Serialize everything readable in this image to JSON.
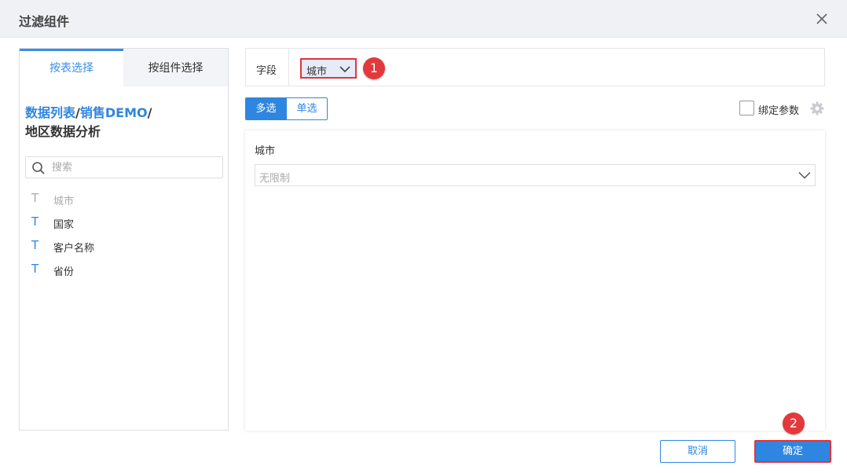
{
  "dialog": {
    "title": "过滤组件",
    "close_icon": "close-icon"
  },
  "left": {
    "tabs": [
      {
        "label": "按表选择",
        "active": true
      },
      {
        "label": "按组件选择",
        "active": false
      }
    ],
    "breadcrumb": {
      "part1": "数据列表",
      "sep1": "/",
      "part2": "销售DEMO",
      "sep2": "/",
      "part3": "地区数据分析"
    },
    "search": {
      "placeholder": "搜索",
      "value": ""
    },
    "fields": [
      {
        "icon": "T",
        "label": "城市",
        "disabled": true
      },
      {
        "icon": "T",
        "label": "国家",
        "disabled": false
      },
      {
        "icon": "T",
        "label": "客户名称",
        "disabled": false
      },
      {
        "icon": "T",
        "label": "省份",
        "disabled": false
      }
    ]
  },
  "field_bar": {
    "label": "字段",
    "selected": "城市"
  },
  "markers": {
    "m1": "1",
    "m2": "2"
  },
  "mode": {
    "multi": "多选",
    "single": "单选",
    "selected": "多选"
  },
  "bind_param": {
    "label": "绑定参数",
    "checked": false
  },
  "preview": {
    "label": "城市",
    "dropdown_value": "无限制"
  },
  "buttons": {
    "cancel": "取消",
    "ok": "确定"
  },
  "colors": {
    "accent": "#2f86e0",
    "highlight": "#e0353b",
    "header_bg": "#f0f1f5"
  }
}
